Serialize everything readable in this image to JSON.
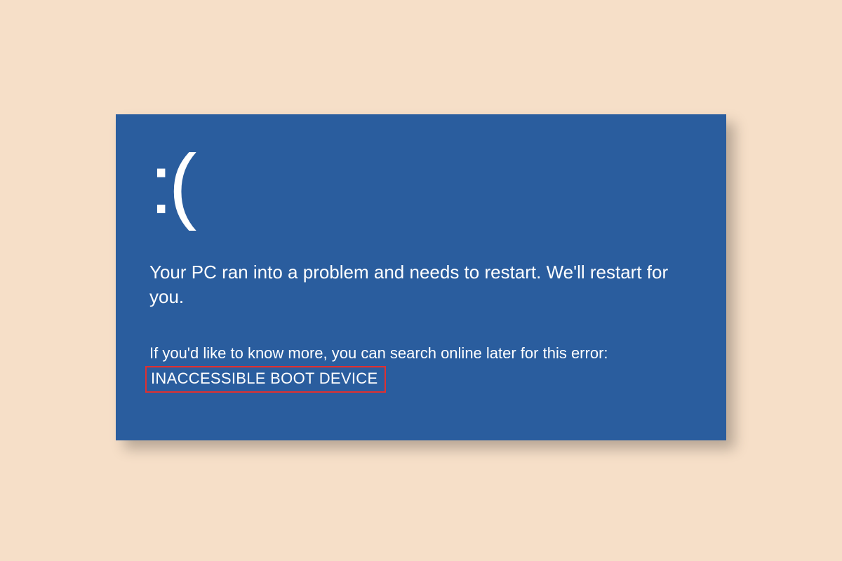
{
  "bsod": {
    "sad_face": ":(",
    "main_message": "Your PC ran into a problem and needs to restart. We'll restart for you.",
    "sub_message": "If you'd like to know more, you can search online later for this error:",
    "error_code": "INACCESSIBLE BOOT DEVICE"
  },
  "colors": {
    "background": "#f6dfc8",
    "bsod_blue": "#2a5d9e",
    "highlight_red": "#e03030"
  }
}
